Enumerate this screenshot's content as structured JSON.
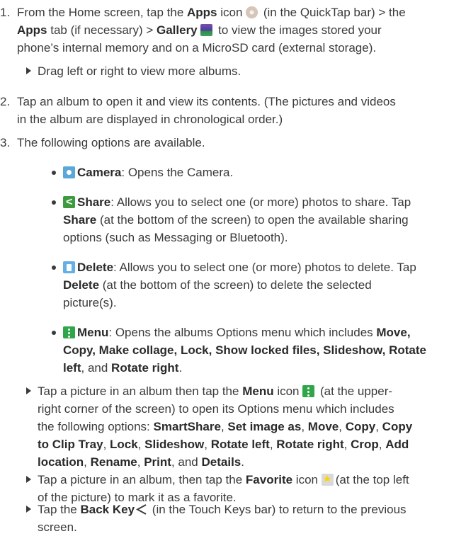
{
  "step1": {
    "number": "1.",
    "line1_a": "From the Home screen, tap the ",
    "apps": "Apps",
    "line1_b": " icon ",
    "line1_c": " (in the QuickTap bar) > the",
    "line2_a": "Apps",
    "line2_b": " tab (if necessary) > ",
    "gallery": "Gallery",
    "line2_c": " to view the images stored your",
    "line3": "phone’s internal memory and on a MicroSD card (external storage).",
    "note": "Drag left or right to view more albums."
  },
  "step2": {
    "number": "2.",
    "line1": "Tap an album to open it and view its contents. (The pictures and videos",
    "line2": "in the album are displayed in chronological order.)"
  },
  "step3": {
    "number": "3.",
    "line1": "The following options are available."
  },
  "options": {
    "camera": {
      "label": "Camera",
      "desc": ": Opens the Camera."
    },
    "share": {
      "label": "Share",
      "l1": ": Allows you to select one (or more) photos to share. Tap",
      "l2_b": "Share",
      "l2": " (at the bottom of the screen) to open the available sharing",
      "l3": "options (such as Messaging or Bluetooth)."
    },
    "delete": {
      "label": "Delete",
      "l1": ": Allows you to select one (or more) photos to delete. Tap",
      "l2_b": "Delete",
      "l2": " (at the bottom of the screen) to delete the selected",
      "l3": "picture(s)."
    },
    "menu": {
      "label": "Menu",
      "l1": ": Opens the albums Options menu which includes ",
      "l1_b": "Move,",
      "l2_b": "Copy, Make collage, Lock, Show locked files, Slideshow, Rotate",
      "l3_b": "left",
      "l3": ", and ",
      "l3_b2": "Rotate right",
      "l3_end": "."
    }
  },
  "note_menu": {
    "l1_a": "Tap a picture in an album then tap the ",
    "menu": "Menu",
    "l1_b": " icon ",
    "l1_c": " (at the upper-",
    "l2": "right corner of the screen) to open its Options menu which includes",
    "l3_a": "the following options: ",
    "smartshare": "SmartShare",
    "sep": ", ",
    "setimage": "Set image as",
    "move": "Move",
    "copy": "Copy",
    "copy_to": "Copy",
    "l4_b": "to Clip Tray",
    "lock": "Lock",
    "slideshow": "Slideshow",
    "rotate_left": "Rotate left",
    "rotate_right": "Rotate right",
    "crop": "Crop",
    "add": "Add",
    "l5_b": "location",
    "rename": "Rename",
    "print": "Print",
    "and": ", and ",
    "details": "Details",
    "end": "."
  },
  "note_fav": {
    "l1_a": "Tap a picture in an album, then tap the ",
    "favorite": "Favorite",
    "l1_b": " icon ",
    "l1_c": "(at the top left",
    "l2": "of the picture) to mark it as a favorite."
  },
  "note_back": {
    "l1_a": "Tap the ",
    "back": "Back Key",
    "l1_b": " (in the Touch Keys bar) to return to the previous",
    "l2": "screen."
  }
}
